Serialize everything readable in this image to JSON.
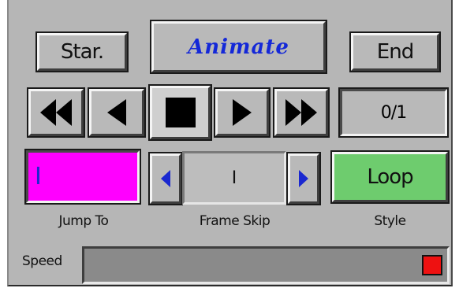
{
  "buttons": {
    "start_label": "Star.",
    "animate_label": "Animate",
    "end_label": "End",
    "style_label": "Loop"
  },
  "frame_counter": "0/1",
  "jump_to": {
    "label": "Jump To",
    "value": "I"
  },
  "frame_skip": {
    "label": "Frame Skip",
    "value": "I"
  },
  "style": {
    "label": "Style"
  },
  "speed": {
    "label": "Speed"
  },
  "icons": {
    "fast_rewind": "fast-rewind-icon",
    "step_back": "step-back-icon",
    "stop": "stop-icon",
    "step_forward": "step-forward-icon",
    "fast_forward": "fast-forward-icon"
  },
  "colors": {
    "panel": "#b6b6b6",
    "animate_text": "#1428d8",
    "jump_to_fill": "#ff00ff",
    "loop_button": "#6ecc6e",
    "speed_indicator": "#ee1111",
    "arrow_blue": "#1a28d0"
  }
}
